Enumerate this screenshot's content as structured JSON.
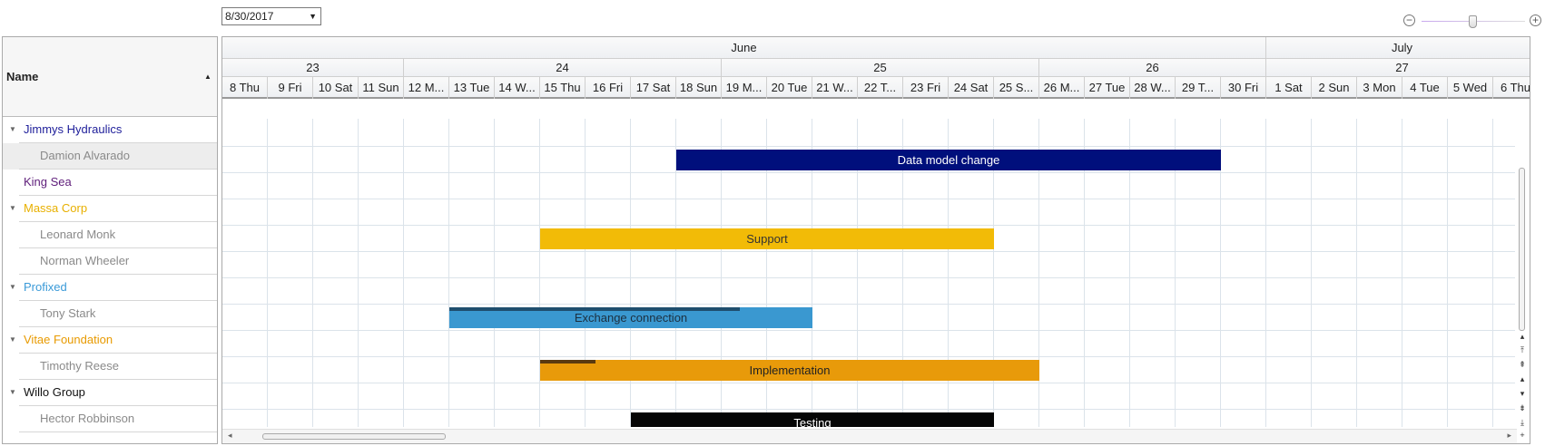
{
  "toolbar": {
    "date_value": "8/30/2017",
    "zoom_out": "−",
    "zoom_in": "+",
    "zoom_level": 0.47
  },
  "tree": {
    "header": "Name",
    "rows": [
      {
        "label": "Jimmys Hydraulics",
        "color": "#1e1e9a",
        "indent": 1,
        "expander": true
      },
      {
        "label": "Damion Alvarado",
        "color": "#8a8a8a",
        "indent": 2,
        "expander": false,
        "selected": true
      },
      {
        "label": "King Sea",
        "color": "#5e1d7a",
        "indent": 1,
        "expander": false
      },
      {
        "label": "Massa Corp",
        "color": "#e8b000",
        "indent": 1,
        "expander": true
      },
      {
        "label": "Leonard Monk",
        "color": "#8a8a8a",
        "indent": 2,
        "expander": false
      },
      {
        "label": "Norman Wheeler",
        "color": "#8a8a8a",
        "indent": 2,
        "expander": false
      },
      {
        "label": "Profixed",
        "color": "#3a9ad8",
        "indent": 1,
        "expander": true
      },
      {
        "label": "Tony Stark",
        "color": "#8a8a8a",
        "indent": 2,
        "expander": false
      },
      {
        "label": "Vitae Foundation",
        "color": "#e89a00",
        "indent": 1,
        "expander": true
      },
      {
        "label": "Timothy Reese",
        "color": "#8a8a8a",
        "indent": 2,
        "expander": false
      },
      {
        "label": "Willo Group",
        "color": "#111111",
        "indent": 1,
        "expander": true
      },
      {
        "label": "Hector Robbinson",
        "color": "#8a8a8a",
        "indent": 2,
        "expander": false
      }
    ]
  },
  "timeline": {
    "months": [
      {
        "label": "June",
        "days": 23
      },
      {
        "label": "July",
        "days": 6
      }
    ],
    "weeks": [
      {
        "label": "23",
        "days": 4
      },
      {
        "label": "24",
        "days": 7
      },
      {
        "label": "25",
        "days": 7
      },
      {
        "label": "26",
        "days": 5
      },
      {
        "label": "27",
        "days": 6
      }
    ],
    "days": [
      "8 Thu",
      "9 Fri",
      "10 Sat",
      "11 Sun",
      "12 M...",
      "13 Tue",
      "14 W...",
      "15 Thu",
      "16 Fri",
      "17 Sat",
      "18 Sun",
      "19 M...",
      "20 Tue",
      "21 W...",
      "22 T...",
      "23 Fri",
      "24 Sat",
      "25 S...",
      "26 M...",
      "27 Tue",
      "28 W...",
      "29 T...",
      "30 Fri",
      "1 Sat",
      "2 Sun",
      "3 Mon",
      "4 Tue",
      "5 Wed",
      "6 Thu"
    ]
  },
  "tasks": [
    {
      "label": "Data model change",
      "row": 1,
      "start": 10,
      "end": 22,
      "fill": "#000f7c",
      "text": "#ffffff",
      "progress": 0,
      "prog_color": "#000000"
    },
    {
      "label": "Support",
      "row": 4,
      "start": 7,
      "end": 17,
      "fill": "#f2bb07",
      "text": "#333333",
      "progress": 0,
      "prog_color": "#000000"
    },
    {
      "label": "Exchange connection",
      "row": 7,
      "start": 5,
      "end": 13,
      "fill": "#3a98d0",
      "text": "#1c2f3f",
      "progress": 0.8,
      "prog_color": "#1f4e6e"
    },
    {
      "label": "Implementation",
      "row": 9,
      "start": 7,
      "end": 18,
      "fill": "#e89a0a",
      "text": "#222222",
      "progress": 0.11,
      "prog_color": "#5a3a10"
    },
    {
      "label": "Testing",
      "row": 11,
      "start": 9,
      "end": 17,
      "fill": "#050505",
      "text": "#ffffff",
      "progress": 0,
      "prog_color": "#000000"
    }
  ]
}
